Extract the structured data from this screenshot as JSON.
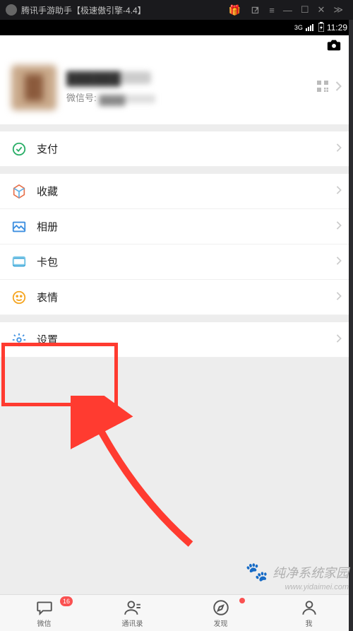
{
  "emulator": {
    "title": "腾讯手游助手【极速傲引擎-4.4】",
    "gift_icon": "🎁"
  },
  "statusbar": {
    "network": "3G",
    "time": "11:29"
  },
  "profile": {
    "nickname_blurred": "██████",
    "wechat_id_label": "微信号:",
    "wechat_id_blurred": "████"
  },
  "menu": {
    "pay": "支付",
    "favorites": "收藏",
    "album": "相册",
    "cards": "卡包",
    "emoji": "表情",
    "settings": "设置"
  },
  "tabs": {
    "chat": {
      "label": "微信",
      "badge": "16"
    },
    "contacts": {
      "label": "通讯录"
    },
    "discover": {
      "label": "发现",
      "dot": true
    },
    "me": {
      "label": "我"
    }
  },
  "watermark": {
    "title": "纯净系统家园",
    "url": "www.yidaimei.com"
  },
  "colors": {
    "accent": "#07c160",
    "highlight": "#ff3b30",
    "badge": "#fa5151"
  }
}
